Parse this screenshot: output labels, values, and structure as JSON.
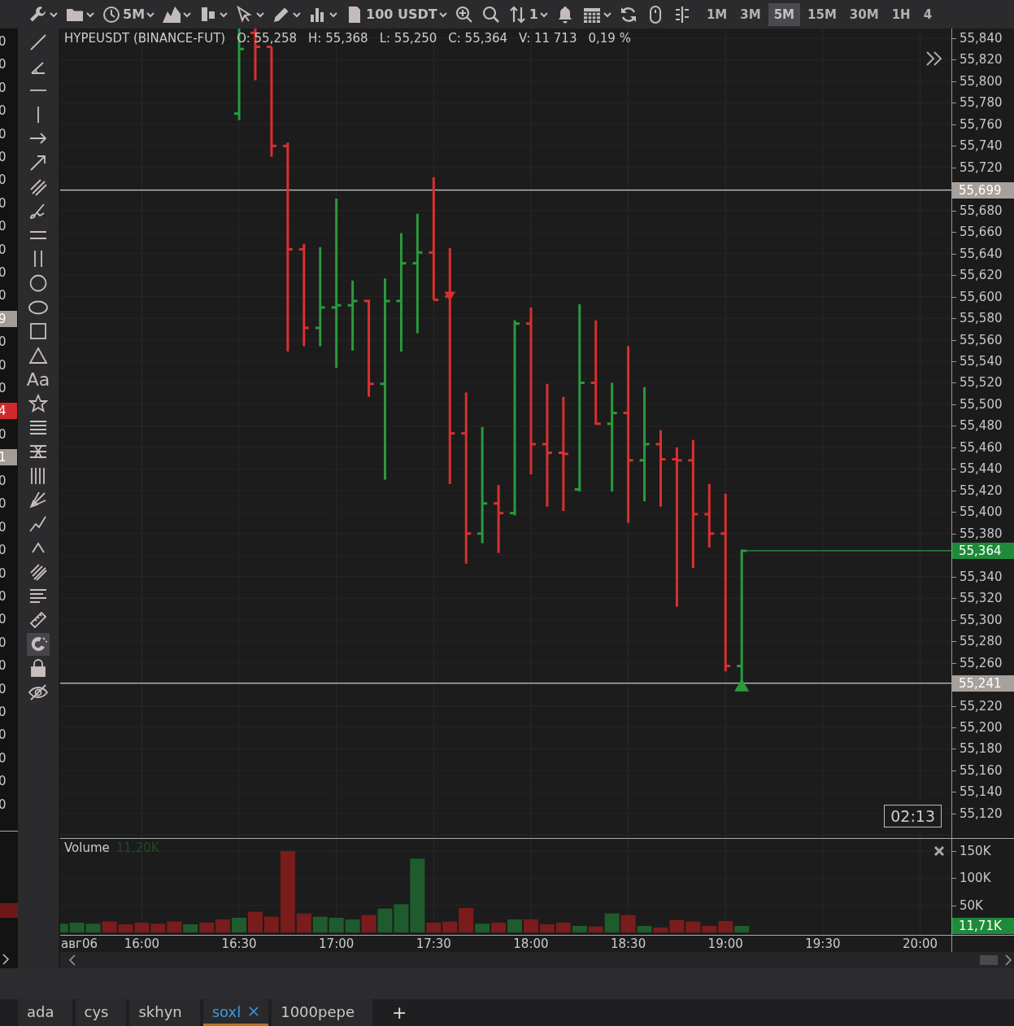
{
  "toolbar": {
    "items": [
      {
        "kind": "wrench",
        "dropdown": true
      },
      {
        "kind": "folder",
        "dropdown": true
      },
      {
        "kind": "clock",
        "label": "5M",
        "dropdown": true
      },
      {
        "kind": "area",
        "dropdown": true
      },
      {
        "kind": "bars",
        "dropdown": true
      },
      {
        "kind": "cursor",
        "dropdown": true
      },
      {
        "kind": "pencil",
        "dropdown": true
      },
      {
        "kind": "indicators",
        "dropdown": true
      },
      {
        "kind": "document",
        "label": "100 USDT",
        "dropdown": true
      },
      {
        "kind": "zoom",
        "dropdown": false
      },
      {
        "kind": "search",
        "dropdown": false
      },
      {
        "kind": "sort",
        "label": "1",
        "dropdown": true
      },
      {
        "kind": "bell",
        "dropdown": false
      },
      {
        "kind": "calendar",
        "dropdown": true
      },
      {
        "kind": "refresh",
        "dropdown": false
      },
      {
        "kind": "mouse",
        "dropdown": false
      },
      {
        "kind": "split",
        "dropdown": false
      }
    ],
    "timeframes": [
      {
        "label": "1M",
        "selected": false
      },
      {
        "label": "3M",
        "selected": false
      },
      {
        "label": "5M",
        "selected": true
      },
      {
        "label": "15M",
        "selected": false
      },
      {
        "label": "30M",
        "selected": false
      },
      {
        "label": "1H",
        "selected": false
      },
      {
        "label": "4",
        "selected": false
      }
    ]
  },
  "left_strip": {
    "labels": [
      {
        "text": "0",
        "kind": "plain"
      },
      {
        "text": "0",
        "kind": "plain"
      },
      {
        "text": "0",
        "kind": "plain"
      },
      {
        "text": "0",
        "kind": "plain"
      },
      {
        "text": "0",
        "kind": "plain"
      },
      {
        "text": "0",
        "kind": "plain"
      },
      {
        "text": "0",
        "kind": "plain"
      },
      {
        "text": "0",
        "kind": "plain"
      },
      {
        "text": "0",
        "kind": "plain"
      },
      {
        "text": "0",
        "kind": "plain"
      },
      {
        "text": "0",
        "kind": "plain"
      },
      {
        "text": "0",
        "kind": "plain"
      },
      {
        "text": "9",
        "kind": "grey"
      },
      {
        "text": "0",
        "kind": "plain"
      },
      {
        "text": "0",
        "kind": "plain"
      },
      {
        "text": "0",
        "kind": "plain"
      },
      {
        "text": "4",
        "kind": "red"
      },
      {
        "text": "0",
        "kind": "plain"
      },
      {
        "text": "1",
        "kind": "grey"
      },
      {
        "text": "0",
        "kind": "plain"
      },
      {
        "text": "0",
        "kind": "plain"
      },
      {
        "text": "0",
        "kind": "plain"
      },
      {
        "text": "0",
        "kind": "plain"
      },
      {
        "text": "0",
        "kind": "plain"
      },
      {
        "text": "0",
        "kind": "plain"
      },
      {
        "text": "0",
        "kind": "plain"
      },
      {
        "text": "0",
        "kind": "plain"
      },
      {
        "text": "0",
        "kind": "plain"
      },
      {
        "text": "0",
        "kind": "plain"
      },
      {
        "text": "0",
        "kind": "plain"
      },
      {
        "text": "0",
        "kind": "plain"
      },
      {
        "text": "0",
        "kind": "plain"
      },
      {
        "text": "0",
        "kind": "plain"
      },
      {
        "text": "0",
        "kind": "plain"
      }
    ]
  },
  "drawing_tools": [
    {
      "kind": "line",
      "selected": false
    },
    {
      "kind": "angle",
      "selected": false
    },
    {
      "kind": "hline",
      "selected": false
    },
    {
      "kind": "vline",
      "selected": false
    },
    {
      "kind": "arrow",
      "selected": false
    },
    {
      "kind": "diag-arrow",
      "selected": false
    },
    {
      "kind": "channel",
      "selected": false
    },
    {
      "kind": "brush",
      "selected": false
    },
    {
      "kind": "double-hline",
      "selected": false
    },
    {
      "kind": "double-vline",
      "selected": false
    },
    {
      "kind": "circle",
      "selected": false
    },
    {
      "kind": "ellipse",
      "selected": false
    },
    {
      "kind": "square",
      "selected": false
    },
    {
      "kind": "triangle",
      "selected": false
    },
    {
      "kind": "text",
      "label": "Aa",
      "selected": false
    },
    {
      "kind": "star",
      "selected": false
    },
    {
      "kind": "levels",
      "selected": false
    },
    {
      "kind": "fan",
      "selected": false
    },
    {
      "kind": "vlevels",
      "selected": false
    },
    {
      "kind": "pitchfork",
      "selected": false
    },
    {
      "kind": "polyline",
      "selected": false
    },
    {
      "kind": "caret",
      "selected": false
    },
    {
      "kind": "hatch",
      "selected": false
    },
    {
      "kind": "text-lines",
      "selected": false
    },
    {
      "kind": "ruler",
      "selected": false
    },
    {
      "kind": "magnet",
      "selected": true
    },
    {
      "kind": "lock",
      "selected": false
    },
    {
      "kind": "eye-off",
      "selected": false
    }
  ],
  "chart": {
    "symbol": "HYPEUSDT (BINANCE-FUT)",
    "stats": [
      "O: 55,258",
      "H: 55,368",
      "L: 55,250",
      "C: 55,364",
      "V: 11 713",
      "0,19 %"
    ],
    "countdown": "02:13",
    "price_axis": {
      "ticks": [
        "55,840",
        "55,820",
        "55,800",
        "55,780",
        "55,760",
        "55,740",
        "55,720",
        "55,680",
        "55,660",
        "55,640",
        "55,620",
        "55,600",
        "55,580",
        "55,560",
        "55,540",
        "55,520",
        "55,500",
        "55,480",
        "55,460",
        "55,440",
        "55,420",
        "55,400",
        "55,380",
        "55,340",
        "55,320",
        "55,300",
        "55,280",
        "55,260",
        "55,220",
        "55,200",
        "55,180",
        "55,160",
        "55,140",
        "55,120"
      ],
      "markers": [
        {
          "label": "55,699",
          "kind": "level"
        },
        {
          "label": "55,364",
          "kind": "last"
        },
        {
          "label": "55,241",
          "kind": "level"
        }
      ]
    }
  },
  "volume": {
    "title": "Volume",
    "value": "11,20K",
    "last_label": "11,71K",
    "axis_labels": [
      "150K",
      "100K",
      "50K"
    ]
  },
  "date_label": "авг06",
  "time_axis": [
    "16:00",
    "16:30",
    "17:00",
    "17:30",
    "18:00",
    "18:30",
    "19:00",
    "19:30",
    "20:00"
  ],
  "tabs": [
    {
      "label": "ada",
      "selected": false,
      "closable": false
    },
    {
      "label": "cys",
      "selected": false,
      "closable": false
    },
    {
      "label": "skhyn",
      "selected": false,
      "closable": false
    },
    {
      "label": "soxl",
      "selected": true,
      "closable": true
    },
    {
      "label": "1000pepe",
      "selected": false,
      "closable": false
    }
  ],
  "add_tab": "+"
}
